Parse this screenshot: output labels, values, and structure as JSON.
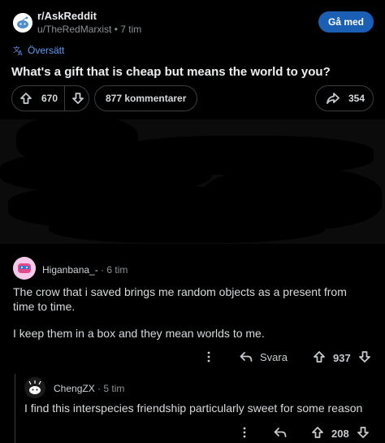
{
  "post": {
    "subreddit": "r/AskReddit",
    "author": "u/TheRedMarxist",
    "time": "7 tim",
    "join_label": "Gå med",
    "translated_label": "Översätt",
    "title": "What's a gift that is cheap but means the world to you?",
    "votes": "670",
    "comments_label": "877 kommentarer",
    "shares": "354"
  },
  "comments": [
    {
      "author": "Higanbana_-",
      "time": "6 tim",
      "body_lines": [
        "The crow that i saved brings me random objects as a present from time to time.",
        "I keep them in a box and they mean worlds to me."
      ],
      "reply_label": "Svara",
      "votes": "937"
    },
    {
      "author": "ChengZX",
      "time": "5 tim",
      "body_lines": [
        "I find this interspecies friendship particularly sweet for some reason"
      ],
      "votes": "208"
    }
  ],
  "colors": {
    "accent_blue": "#1a5fb4",
    "link_blue": "#5b9bf0",
    "background": "#000000"
  },
  "icons": {
    "translate": "translate-icon",
    "upvote": "arrow-up-icon",
    "downvote": "arrow-down-icon",
    "share": "share-arrow-icon",
    "more": "more-vertical-icon",
    "reply": "reply-icon"
  }
}
